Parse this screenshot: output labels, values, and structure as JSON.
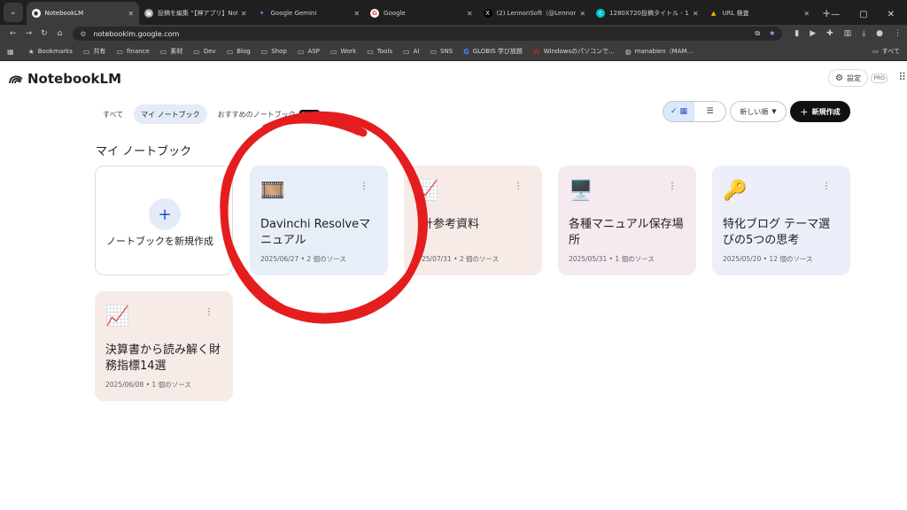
{
  "browser": {
    "tabs": [
      {
        "title": "NotebookLM",
        "active": true,
        "favicon": "notebooklm-favicon",
        "color": "#ffffff"
      },
      {
        "title": "投稿を編集 “【神アプリ】Notebo",
        "active": false,
        "favicon": "wordpress-favicon",
        "color": "#9e9e9e"
      },
      {
        "title": "Google Gemini",
        "active": false,
        "favicon": "gemini-favicon",
        "color": "#6b8cff"
      },
      {
        "title": "Google",
        "active": false,
        "favicon": "google-favicon",
        "color": "#ea4335"
      },
      {
        "title": "(2) LennonSoft（@Lennon_Sof",
        "active": false,
        "favicon": "x-favicon",
        "color": "#000000"
      },
      {
        "title": "1280X720投稿タイトル - 1280 ×",
        "active": false,
        "favicon": "canva-favicon",
        "color": "#00c4cc"
      },
      {
        "title": "URL 検査",
        "active": false,
        "favicon": "search-console-favicon",
        "color": "#f4b400"
      }
    ],
    "url": "notebooklm.google.com",
    "bookmarks": [
      {
        "label": "Bookmarks",
        "icon": "star-icon"
      },
      {
        "label": "共有",
        "icon": "folder-icon"
      },
      {
        "label": "finance",
        "icon": "folder-icon"
      },
      {
        "label": "素材",
        "icon": "folder-icon"
      },
      {
        "label": "Dev",
        "icon": "folder-icon"
      },
      {
        "label": "Blog",
        "icon": "folder-icon"
      },
      {
        "label": "Shop",
        "icon": "folder-icon"
      },
      {
        "label": "ASP",
        "icon": "folder-icon"
      },
      {
        "label": "Work",
        "icon": "folder-icon"
      },
      {
        "label": "Tools",
        "icon": "folder-icon"
      },
      {
        "label": "AI",
        "icon": "folder-icon"
      },
      {
        "label": "SNS",
        "icon": "folder-icon"
      },
      {
        "label": "GLOBIS 学び放題",
        "icon": "globis-icon"
      },
      {
        "label": "Windowsのパソコンで...",
        "icon": "windows-icon"
      },
      {
        "label": "manabien（MAM...",
        "icon": "globe-icon"
      }
    ],
    "bookmarks_right": "すべて"
  },
  "header": {
    "app_name": "NotebookLM",
    "settings_label": "設定",
    "pro_label": "PRO"
  },
  "filters": {
    "all": "すべて",
    "mine": "マイ ノートブック",
    "featured": "おすすめのノートブック",
    "new_badge": "New!"
  },
  "controls": {
    "sort_label": "新しい順",
    "create_label": "新規作成"
  },
  "section_title": "マイ ノートブック",
  "new_notebook_label": "ノートブックを新規作成",
  "notebooks": [
    {
      "emoji": "🎞️",
      "title": "Davinchi Resolveマニュアル",
      "meta": "2025/06/27 • 2 個のソース",
      "bg": "#e8eef8"
    },
    {
      "emoji": "📈",
      "title": "計参考資料",
      "meta": "25/07/31 • 2 個のソース",
      "bg": "#f7ebe8"
    },
    {
      "emoji": "🖥️",
      "title": "各種マニュアル保存場所",
      "meta": "2025/05/31 • 1 個のソース",
      "bg": "#f4eaf0"
    },
    {
      "emoji": "🔑",
      "title": "特化ブログ テーマ選びの5つの思考",
      "meta": "2025/05/20 • 12 個のソース",
      "bg": "#eceef9"
    },
    {
      "emoji": "📈",
      "title": "決算書から読み解く財務指標14選",
      "meta": "2025/06/08 • 1 個のソース",
      "bg": "#f7ebe8"
    }
  ],
  "annotation": {
    "color": "#e41e1e"
  }
}
